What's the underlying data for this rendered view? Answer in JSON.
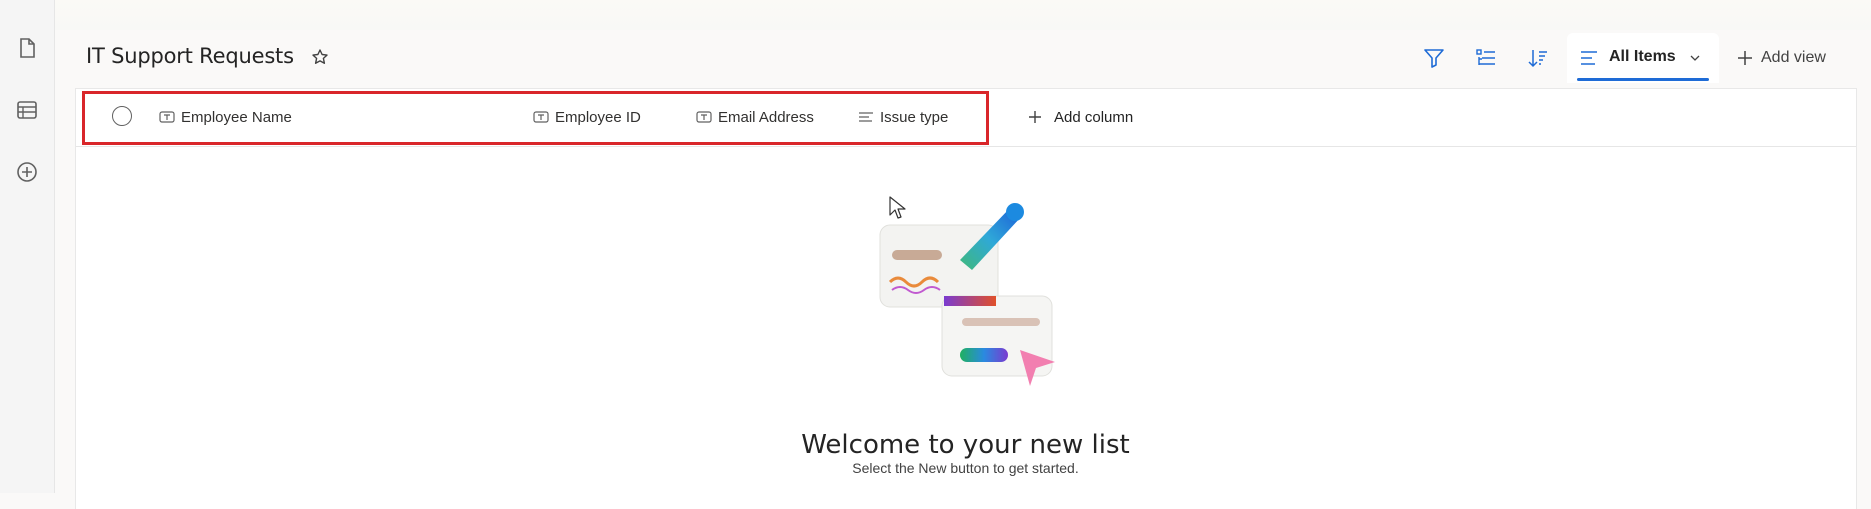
{
  "list": {
    "title": "IT Support Requests"
  },
  "toolbar": {
    "view_label": "All Items",
    "add_view_label": "Add view"
  },
  "columns": [
    {
      "label": "Employee Name",
      "icon": "text-field-icon"
    },
    {
      "label": "Employee ID",
      "icon": "text-field-icon"
    },
    {
      "label": "Email Address",
      "icon": "text-field-icon"
    },
    {
      "label": "Issue type",
      "icon": "choice-field-icon"
    }
  ],
  "add_column_label": "Add column",
  "empty_state": {
    "heading": "Welcome to your new list",
    "subtitle": "Select the New button to get started."
  },
  "colors": {
    "accent": "#1e6bd6",
    "highlight": "#d9262a"
  }
}
